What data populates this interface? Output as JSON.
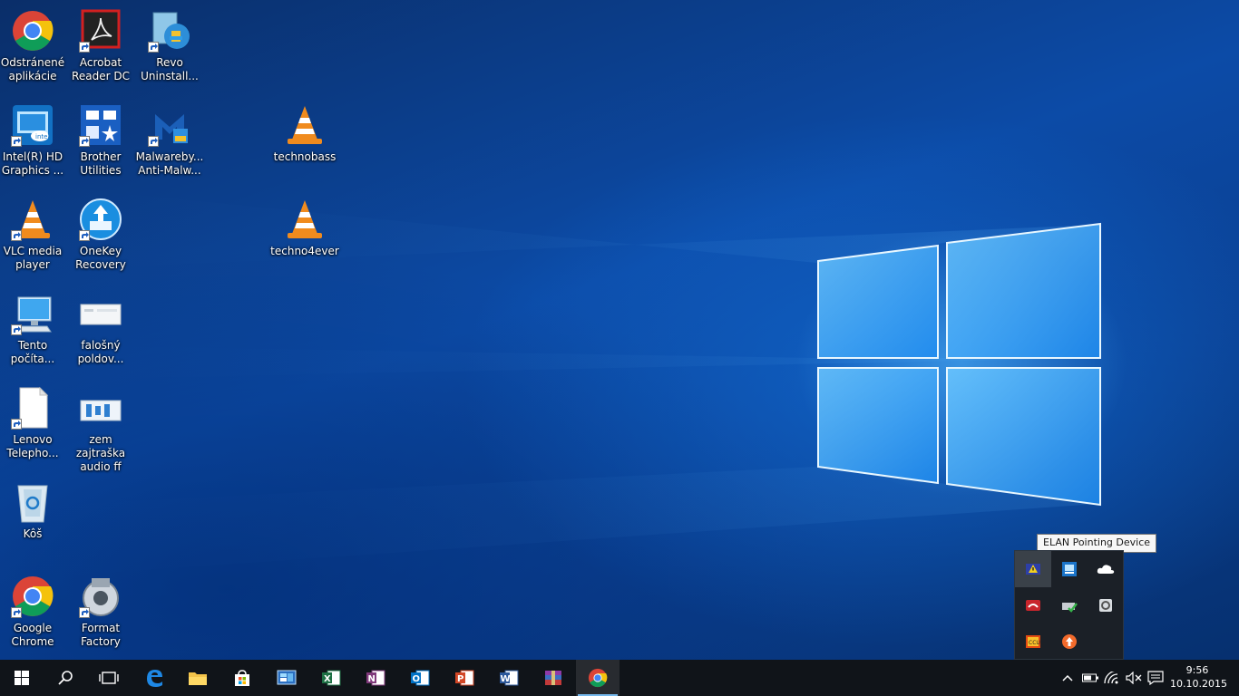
{
  "desktop": {
    "icons": [
      {
        "label": "Odstránené aplikácie"
      },
      {
        "label": "Acrobat Reader DC"
      },
      {
        "label": "Revo Uninstall..."
      },
      {
        "label": "Intel(R) HD Graphics ..."
      },
      {
        "label": "Brother Utilities"
      },
      {
        "label": "Malwareby... Anti-Malw..."
      },
      {
        "label": "technobass"
      },
      {
        "label": "VLC media player"
      },
      {
        "label": "OneKey Recovery"
      },
      {
        "label": "techno4ever"
      },
      {
        "label": "Tento počíta..."
      },
      {
        "label": "falošný poldov..."
      },
      {
        "label": "Lenovo Telepho..."
      },
      {
        "label": "zem zajtraška audio ff"
      },
      {
        "label": "Kôš"
      },
      {
        "label": "Google Chrome"
      },
      {
        "label": "Format Factory"
      }
    ]
  },
  "tray_overflow": {
    "tooltip": "ELAN Pointing Device",
    "items": [
      "elan-pointing-device-icon",
      "intel-graphics-tray-icon",
      "onedrive-icon",
      "phone-tray-icon",
      "safely-remove-hardware-icon",
      "ccleaner-tray-icon",
      "ccu-tray-icon",
      "update-arrow-icon"
    ]
  },
  "taskbar": {
    "pinned": [
      "start-icon",
      "search-icon",
      "task-view-icon",
      "edge-icon",
      "file-explorer-icon",
      "store-icon",
      "control-panel-icon",
      "excel-icon",
      "onenote-icon",
      "outlook-icon",
      "powerpoint-icon",
      "word-icon",
      "winrar-icon",
      "chrome-icon"
    ],
    "active": "chrome-icon",
    "clock": {
      "time": "9:56",
      "date": "10.10.2015"
    }
  },
  "colors": {
    "accent": "#76b9ed",
    "taskbar": "#101419",
    "wallpaper": "#0c4ba7"
  }
}
